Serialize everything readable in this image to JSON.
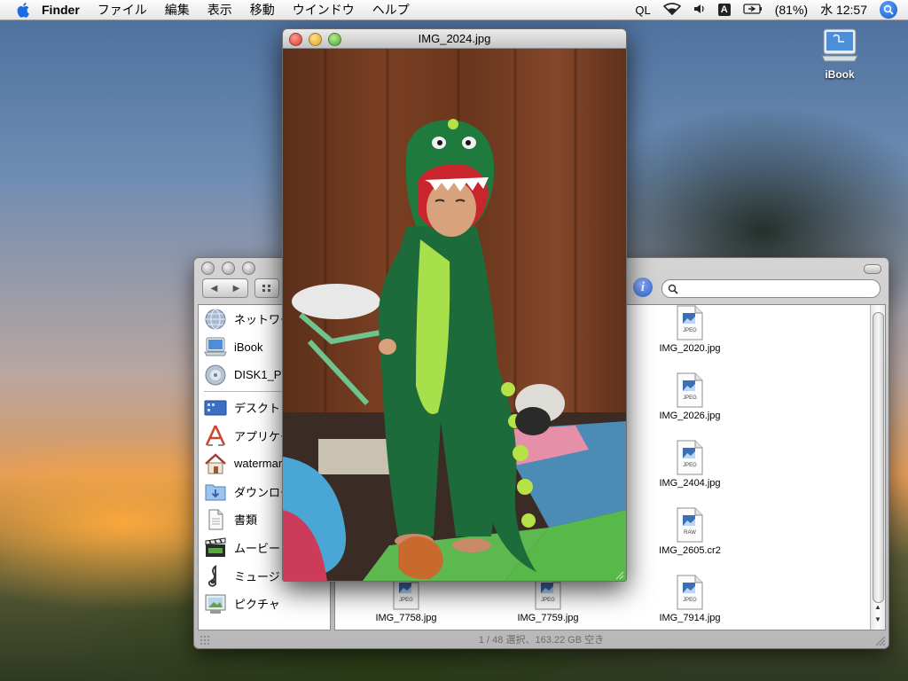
{
  "menubar": {
    "app": "Finder",
    "items": [
      "ファイル",
      "編集",
      "表示",
      "移動",
      "ウインドウ",
      "ヘルプ"
    ],
    "status": {
      "ql": "QL",
      "battery": "(81%)",
      "clock": "水 12:57",
      "input_method": "A"
    }
  },
  "desktop": {
    "icons": [
      {
        "label": "iBook",
        "icon": "ibook-computer-icon"
      }
    ]
  },
  "preview": {
    "title": "IMG_2024.jpg"
  },
  "finder": {
    "search_placeholder": "",
    "sidebar": [
      {
        "label": "ネットワーク",
        "icon": "network-globe-icon"
      },
      {
        "label": "iBook",
        "icon": "ibook-computer-icon"
      },
      {
        "label": "DISK1_PT1",
        "icon": "disk-icon"
      },
      {
        "separator": true
      },
      {
        "label": "デスクトップ",
        "icon": "desktop-icon"
      },
      {
        "label": "アプリケーション",
        "icon": "applications-icon"
      },
      {
        "label": "watermark",
        "icon": "home-icon"
      },
      {
        "label": "ダウンロード",
        "icon": "downloads-folder-icon"
      },
      {
        "label": "書類",
        "icon": "documents-icon"
      },
      {
        "label": "ムービー",
        "icon": "movies-icon"
      },
      {
        "label": "ミュージック",
        "icon": "music-icon"
      },
      {
        "label": "ピクチャ",
        "icon": "pictures-icon"
      }
    ],
    "files": [
      {
        "name": "IMG_2020.jpg",
        "kind": "JPEG"
      },
      {
        "name": "IMG_2026.jpg",
        "kind": "JPEG"
      },
      {
        "name": "IMG_2404.jpg",
        "kind": "JPEG"
      },
      {
        "name": "IMG_2605.cr2",
        "kind": "RAW"
      },
      {
        "name": "IMG_7758.jpg",
        "kind": "JPEG"
      },
      {
        "name": "IMG_7759.jpg",
        "kind": "JPEG"
      },
      {
        "name": "IMG_7914.jpg",
        "kind": "JPEG"
      }
    ],
    "status": "1 / 48 選択、163.22 GB 空き"
  },
  "colors": {
    "menubar_bg": "#eeeeee",
    "selection_blue": "#2c5fc8",
    "close_red": "#e2463f",
    "minimize_yellow": "#e8b232",
    "zoom_green": "#58b13d"
  }
}
